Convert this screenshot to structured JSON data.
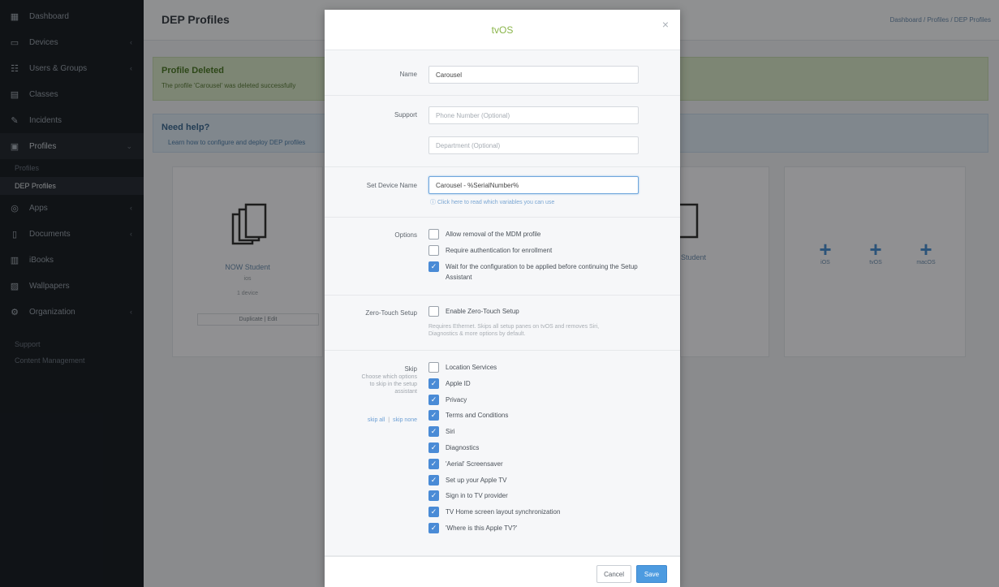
{
  "sidebar": {
    "items": [
      {
        "label": "Dashboard",
        "icon": "grid-icon",
        "caret": false
      },
      {
        "label": "Devices",
        "icon": "monitor-icon",
        "caret": true
      },
      {
        "label": "Users & Groups",
        "icon": "users-icon",
        "caret": true
      },
      {
        "label": "Classes",
        "icon": "classes-icon",
        "caret": false
      },
      {
        "label": "Incidents",
        "icon": "pen-icon",
        "caret": false
      },
      {
        "label": "Profiles",
        "icon": "profiles-icon",
        "caret": true,
        "active": true
      }
    ],
    "sub_items": [
      {
        "label": "Profiles",
        "selected": false
      },
      {
        "label": "DEP Profiles",
        "selected": true
      }
    ],
    "items_after": [
      {
        "label": "Apps",
        "icon": "apps-icon",
        "caret": true
      },
      {
        "label": "Documents",
        "icon": "document-icon",
        "caret": true
      },
      {
        "label": "iBooks",
        "icon": "book-icon",
        "caret": false
      },
      {
        "label": "Wallpapers",
        "icon": "image-icon",
        "caret": false
      },
      {
        "label": "Organization",
        "icon": "gear-icon",
        "caret": true
      }
    ],
    "footer": [
      "Support",
      "Content Management"
    ]
  },
  "topbar": {
    "title": "DEP Profiles",
    "crumbs": "Dashboard / Profiles / DEP Profiles"
  },
  "alert_success": {
    "heading": "Profile Deleted",
    "text": "The profile 'Carousel' was deleted successfully"
  },
  "alert_info": {
    "heading": "Need help?",
    "text": "Learn how to configure and deploy DEP profiles"
  },
  "cards": [
    {
      "name": "NOW Student",
      "sub": "ios",
      "meta": "1 device",
      "actions": "Duplicate | Edit"
    },
    {
      "name": "Student",
      "sub": "",
      "meta": "",
      "actions": ""
    }
  ],
  "add_buttons": [
    "iOS",
    "tvOS",
    "macOS"
  ],
  "modal": {
    "title": "tvOS",
    "close_glyph": "×",
    "name_label": "Name",
    "name_value": "Carousel",
    "support_label": "Support",
    "phone_placeholder": "Phone Number (Optional)",
    "department_placeholder": "Department (Optional)",
    "device_name_label": "Set Device Name",
    "device_name_value": "Carousel - %SerialNumber%",
    "device_name_hint": "Click here to read which variables you can use",
    "options_label": "Options",
    "options": [
      {
        "text": "Allow removal of the MDM profile",
        "checked": false
      },
      {
        "text": "Require authentication for enrollment",
        "checked": false
      },
      {
        "text": "Wait for the configuration to be applied before continuing the Setup Assistant",
        "checked": true
      }
    ],
    "zero_touch_label": "Zero-Touch Setup",
    "zero_touch_option": "Enable Zero-Touch Setup",
    "zero_touch_checked": false,
    "zero_touch_hint": "Requires Ethernet. Skips all setup panes on tvOS and removes Siri, Diagnostics & more options by default.",
    "skip_label": "Skip",
    "skip_note": "Choose which options to skip in the setup assistant",
    "skip_all": "skip all",
    "skip_separator": "|",
    "skip_none": "skip none",
    "skip_items": [
      {
        "text": "Location Services",
        "checked": false
      },
      {
        "text": "Apple ID",
        "checked": true
      },
      {
        "text": "Privacy",
        "checked": true
      },
      {
        "text": "Terms and Conditions",
        "checked": true
      },
      {
        "text": "Siri",
        "checked": true
      },
      {
        "text": "Diagnostics",
        "checked": true
      },
      {
        "text": "'Aerial' Screensaver",
        "checked": true
      },
      {
        "text": "Set up your Apple TV",
        "checked": true
      },
      {
        "text": "Sign in to TV provider",
        "checked": true
      },
      {
        "text": "TV Home screen layout synchronization",
        "checked": true
      },
      {
        "text": "'Where is this Apple TV?'",
        "checked": true
      }
    ],
    "cancel_label": "Cancel",
    "save_label": "Save"
  }
}
